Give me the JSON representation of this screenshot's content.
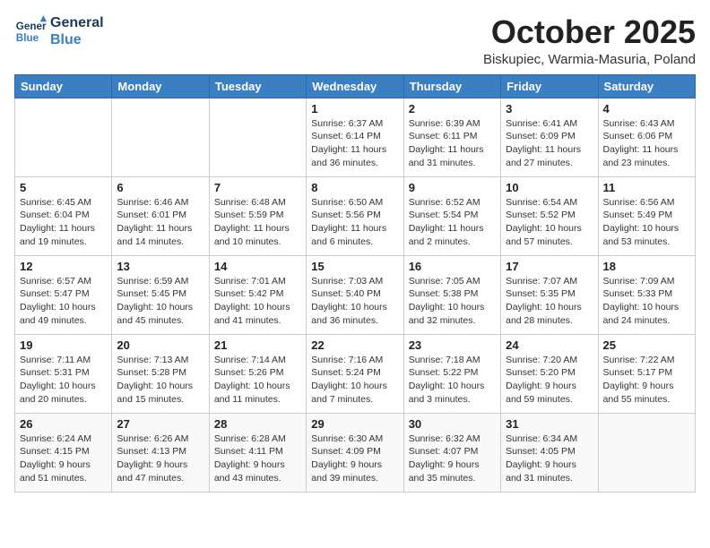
{
  "header": {
    "logo_line1": "General",
    "logo_line2": "Blue",
    "month": "October 2025",
    "location": "Biskupiec, Warmia-Masuria, Poland"
  },
  "weekdays": [
    "Sunday",
    "Monday",
    "Tuesday",
    "Wednesday",
    "Thursday",
    "Friday",
    "Saturday"
  ],
  "weeks": [
    [
      {
        "day": "",
        "info": ""
      },
      {
        "day": "",
        "info": ""
      },
      {
        "day": "",
        "info": ""
      },
      {
        "day": "1",
        "info": "Sunrise: 6:37 AM\nSunset: 6:14 PM\nDaylight: 11 hours\nand 36 minutes."
      },
      {
        "day": "2",
        "info": "Sunrise: 6:39 AM\nSunset: 6:11 PM\nDaylight: 11 hours\nand 31 minutes."
      },
      {
        "day": "3",
        "info": "Sunrise: 6:41 AM\nSunset: 6:09 PM\nDaylight: 11 hours\nand 27 minutes."
      },
      {
        "day": "4",
        "info": "Sunrise: 6:43 AM\nSunset: 6:06 PM\nDaylight: 11 hours\nand 23 minutes."
      }
    ],
    [
      {
        "day": "5",
        "info": "Sunrise: 6:45 AM\nSunset: 6:04 PM\nDaylight: 11 hours\nand 19 minutes."
      },
      {
        "day": "6",
        "info": "Sunrise: 6:46 AM\nSunset: 6:01 PM\nDaylight: 11 hours\nand 14 minutes."
      },
      {
        "day": "7",
        "info": "Sunrise: 6:48 AM\nSunset: 5:59 PM\nDaylight: 11 hours\nand 10 minutes."
      },
      {
        "day": "8",
        "info": "Sunrise: 6:50 AM\nSunset: 5:56 PM\nDaylight: 11 hours\nand 6 minutes."
      },
      {
        "day": "9",
        "info": "Sunrise: 6:52 AM\nSunset: 5:54 PM\nDaylight: 11 hours\nand 2 minutes."
      },
      {
        "day": "10",
        "info": "Sunrise: 6:54 AM\nSunset: 5:52 PM\nDaylight: 10 hours\nand 57 minutes."
      },
      {
        "day": "11",
        "info": "Sunrise: 6:56 AM\nSunset: 5:49 PM\nDaylight: 10 hours\nand 53 minutes."
      }
    ],
    [
      {
        "day": "12",
        "info": "Sunrise: 6:57 AM\nSunset: 5:47 PM\nDaylight: 10 hours\nand 49 minutes."
      },
      {
        "day": "13",
        "info": "Sunrise: 6:59 AM\nSunset: 5:45 PM\nDaylight: 10 hours\nand 45 minutes."
      },
      {
        "day": "14",
        "info": "Sunrise: 7:01 AM\nSunset: 5:42 PM\nDaylight: 10 hours\nand 41 minutes."
      },
      {
        "day": "15",
        "info": "Sunrise: 7:03 AM\nSunset: 5:40 PM\nDaylight: 10 hours\nand 36 minutes."
      },
      {
        "day": "16",
        "info": "Sunrise: 7:05 AM\nSunset: 5:38 PM\nDaylight: 10 hours\nand 32 minutes."
      },
      {
        "day": "17",
        "info": "Sunrise: 7:07 AM\nSunset: 5:35 PM\nDaylight: 10 hours\nand 28 minutes."
      },
      {
        "day": "18",
        "info": "Sunrise: 7:09 AM\nSunset: 5:33 PM\nDaylight: 10 hours\nand 24 minutes."
      }
    ],
    [
      {
        "day": "19",
        "info": "Sunrise: 7:11 AM\nSunset: 5:31 PM\nDaylight: 10 hours\nand 20 minutes."
      },
      {
        "day": "20",
        "info": "Sunrise: 7:13 AM\nSunset: 5:28 PM\nDaylight: 10 hours\nand 15 minutes."
      },
      {
        "day": "21",
        "info": "Sunrise: 7:14 AM\nSunset: 5:26 PM\nDaylight: 10 hours\nand 11 minutes."
      },
      {
        "day": "22",
        "info": "Sunrise: 7:16 AM\nSunset: 5:24 PM\nDaylight: 10 hours\nand 7 minutes."
      },
      {
        "day": "23",
        "info": "Sunrise: 7:18 AM\nSunset: 5:22 PM\nDaylight: 10 hours\nand 3 minutes."
      },
      {
        "day": "24",
        "info": "Sunrise: 7:20 AM\nSunset: 5:20 PM\nDaylight: 9 hours\nand 59 minutes."
      },
      {
        "day": "25",
        "info": "Sunrise: 7:22 AM\nSunset: 5:17 PM\nDaylight: 9 hours\nand 55 minutes."
      }
    ],
    [
      {
        "day": "26",
        "info": "Sunrise: 6:24 AM\nSunset: 4:15 PM\nDaylight: 9 hours\nand 51 minutes."
      },
      {
        "day": "27",
        "info": "Sunrise: 6:26 AM\nSunset: 4:13 PM\nDaylight: 9 hours\nand 47 minutes."
      },
      {
        "day": "28",
        "info": "Sunrise: 6:28 AM\nSunset: 4:11 PM\nDaylight: 9 hours\nand 43 minutes."
      },
      {
        "day": "29",
        "info": "Sunrise: 6:30 AM\nSunset: 4:09 PM\nDaylight: 9 hours\nand 39 minutes."
      },
      {
        "day": "30",
        "info": "Sunrise: 6:32 AM\nSunset: 4:07 PM\nDaylight: 9 hours\nand 35 minutes."
      },
      {
        "day": "31",
        "info": "Sunrise: 6:34 AM\nSunset: 4:05 PM\nDaylight: 9 hours\nand 31 minutes."
      },
      {
        "day": "",
        "info": ""
      }
    ]
  ]
}
